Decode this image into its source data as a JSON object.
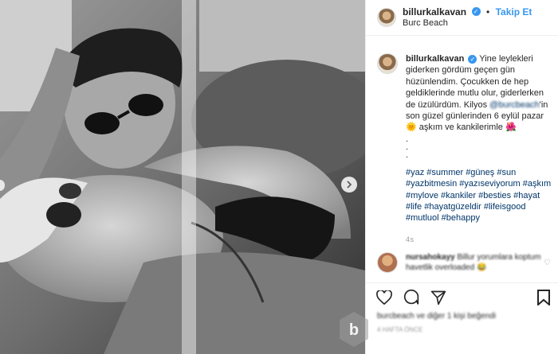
{
  "post": {
    "username": "billurkalkavan",
    "follow_label": "Takip Et",
    "location": "Burc Beach",
    "caption_text": "Yine leylekleri giderken gördüm geçen gün hüzünlendim. Çocukken de hep geldiklerinde mutlu olur, giderlerken de üzülürdüm. Kilyos",
    "caption_mention": "@burcbeach",
    "caption_after": "'in son güzel günlerinden 6 eylül pazar",
    "caption_sun": "🌞",
    "caption_love": "aşkım ve kankilerimle",
    "caption_flower": "🌺",
    "dots": ".\n.\n.",
    "hashtags": "#yaz #summer #güneş #sun #yazbitmesin #yazıseviyorum #aşkım #mylove #kankiler #besties #hayat #life #hayatgüzeldir #lifeisgood #mutluol #behappy",
    "time_ago": "4s"
  },
  "comment": {
    "username": "nursahokayy",
    "text": "Billur yorumlara koptum havetlik overloaded",
    "emoji": "😂"
  },
  "likes_text": "burcbeach ve diğer 1 kişi beğendi",
  "date_text": "4 HAFTA ÖNCE",
  "icons": {
    "verified": "verified-badge-icon",
    "like": "heart-icon",
    "comment": "comment-icon",
    "share": "share-icon",
    "save": "bookmark-icon",
    "next": "chevron-right-icon"
  }
}
